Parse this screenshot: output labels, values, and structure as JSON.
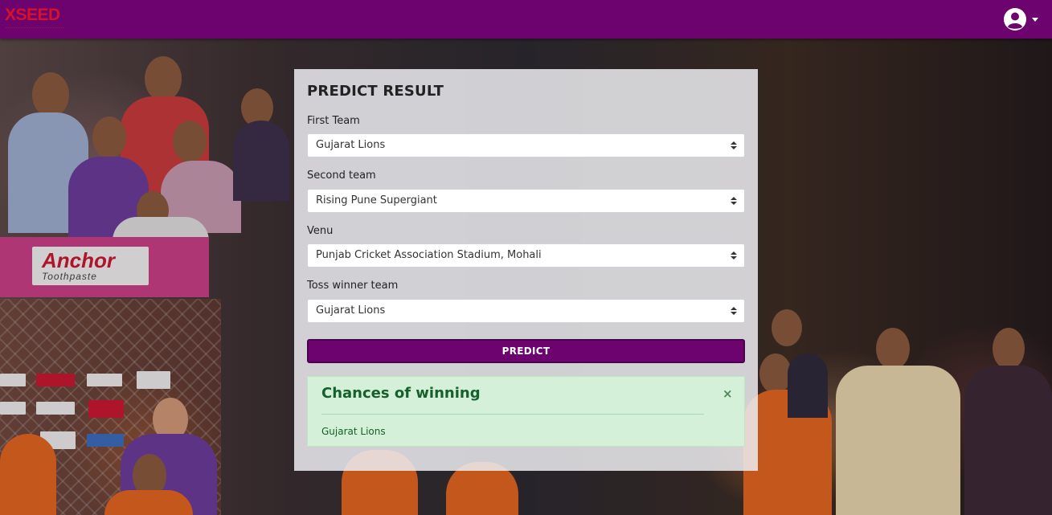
{
  "navbar": {
    "brand": "XSEED",
    "user_icon": "user-circle-icon",
    "color": "#6c036f"
  },
  "background": {
    "banner_brand": "Anchor",
    "banner_sub": "Toothpaste"
  },
  "form": {
    "title": "PREDICT RESULT",
    "first_team": {
      "label": "First Team",
      "value": "Gujarat Lions"
    },
    "second_team": {
      "label": "Second team",
      "value": "Rising Pune Supergiant"
    },
    "venue": {
      "label": "Venu",
      "value": "Punjab Cricket Association Stadium, Mohali"
    },
    "toss_winner": {
      "label": "Toss winner team",
      "value": "Gujarat Lions"
    },
    "predict_label": "PREDICT",
    "button_color": "#6c036f"
  },
  "result": {
    "title": "Chances of winning",
    "winner": "Gujarat Lions",
    "close_icon": "close-icon",
    "close_symbol": "×",
    "color": "#d4f0d9"
  }
}
